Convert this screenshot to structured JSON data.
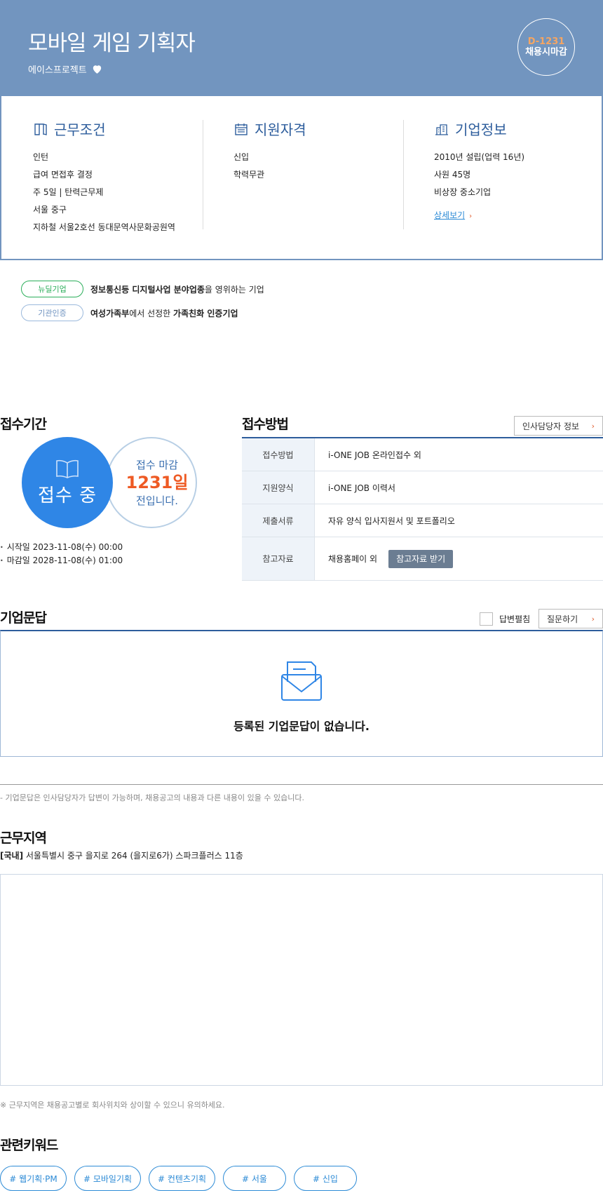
{
  "header": {
    "title": "모바일 게임 기획자",
    "company": "에이스프로젝트",
    "dday": "D-1231",
    "close_type": "채용시마감"
  },
  "conditions": {
    "title": "근무조건",
    "items": [
      "인턴",
      "급여 면접후 결정",
      "주 5일 | 탄력근무제",
      "서울 중구",
      "지하철 서울2호선 동대문역사문화공원역"
    ]
  },
  "qualifications": {
    "title": "지원자격",
    "items": [
      "신입",
      "학력무관"
    ]
  },
  "company_info": {
    "title": "기업정보",
    "items": [
      "2010년 설립(업력 16년)",
      "사원 45명",
      "비상장 중소기업"
    ],
    "more_label": "상세보기"
  },
  "badges": [
    {
      "label": "뉴딜기업",
      "text_bold": "정보통신등 디지털사업 분야업종",
      "text_rest": "을 영위하는 기업"
    },
    {
      "label": "기관인증",
      "text_bold": "여성가족부",
      "text_mid": "에서 선정한 ",
      "text_bold2": "가족친화 인증기업"
    }
  ],
  "period": {
    "title": "접수기간",
    "status": "접수 중",
    "line1": "접수 마감",
    "days": "1231일",
    "line3": "전입니다.",
    "start": "시작일 2023-11-08(수) 00:00",
    "end": "마감일 2028-11-08(수) 01:00"
  },
  "method": {
    "title": "접수방법",
    "hr_button": "인사담당자 정보",
    "rows": [
      {
        "label": "접수방법",
        "value": "i-ONE JOB 온라인접수 외"
      },
      {
        "label": "지원양식",
        "value": "i-ONE JOB 이력서"
      },
      {
        "label": "제출서류",
        "value": "자유 양식 입사지원서 및 포트폴리오"
      },
      {
        "label": "참고자료",
        "value": "채용홈페이 외",
        "button": "참고자료 받기"
      }
    ]
  },
  "qa": {
    "title": "기업문답",
    "check_label": "답변펼침",
    "ask_button": "질문하기",
    "empty": "등록된 기업문답이 없습니다.",
    "note": "- 기업문답은 인사담당자가 답변이 가능하며, 채용공고의 내용과 다른 내용이 있을 수 있습니다."
  },
  "location": {
    "title": "근무지역",
    "tag": "[국내]",
    "address": " 서울특별시 중구 을지로 264 (을지로6가) 스파크플러스 11층",
    "note": "※ 근무지역은 채용공고별로 회사위치와 상이할 수 있으니 유의하세요."
  },
  "keywords": {
    "title": "관련키워드",
    "items": [
      "# 웹기획·PM",
      "# 모바일기획",
      "# 컨텐츠기획",
      "# 서울",
      "# 신입"
    ]
  },
  "colors": {
    "header_bg": "#7295bf",
    "accent_blue": "#2f86e6",
    "accent_orange": "#ee5a24",
    "navy": "#2d5d9c"
  }
}
